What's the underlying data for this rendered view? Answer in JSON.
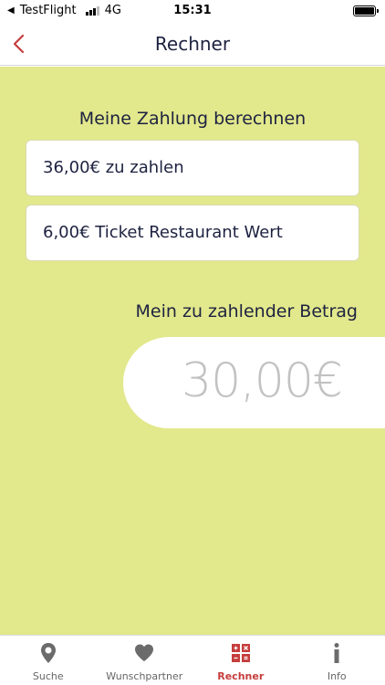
{
  "status_bar": {
    "back_app": "TestFlight",
    "network": "4G",
    "time": "15:31"
  },
  "nav": {
    "title": "Rechner",
    "accent_color": "#c63d3d"
  },
  "calculator": {
    "section_title": "Meine Zahlung berechnen",
    "amount_to_pay": "36,00€ zu zahlen",
    "ticket_value": "6,00€ Ticket Restaurant Wert",
    "result_label": "Mein zu zahlender Betrag",
    "result_value": "30,00€",
    "background_color": "#e2e88c"
  },
  "tabs": [
    {
      "label": "Suche",
      "icon": "location-pin-icon"
    },
    {
      "label": "Wunschpartner",
      "icon": "heart-icon"
    },
    {
      "label": "Rechner",
      "icon": "calculator-icon",
      "active": true
    },
    {
      "label": "Info",
      "icon": "info-icon"
    }
  ]
}
